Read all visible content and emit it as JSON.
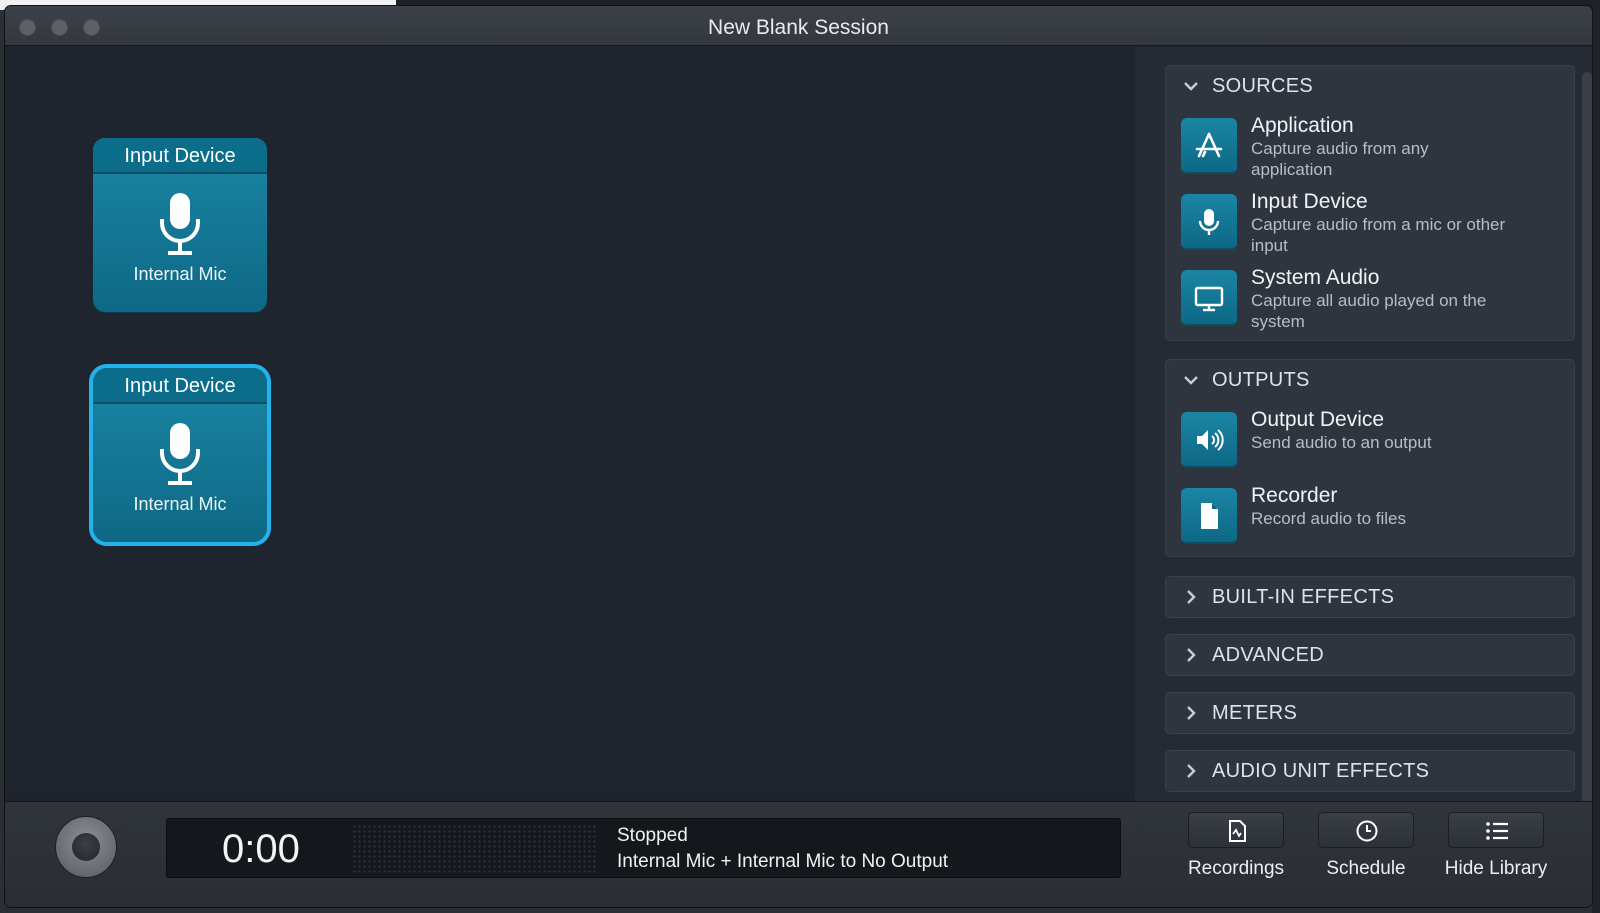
{
  "window": {
    "title": "New Blank Session"
  },
  "canvas": {
    "nodes": [
      {
        "header": "Input Device",
        "label": "Internal Mic",
        "selected": false
      },
      {
        "header": "Input Device",
        "label": "Internal Mic",
        "selected": true
      }
    ]
  },
  "library": {
    "sources": {
      "header": "SOURCES",
      "items": [
        {
          "title": "Application",
          "desc": "Capture audio from any application",
          "icon": "app-store-icon"
        },
        {
          "title": "Input Device",
          "desc": "Capture audio from a mic or other input",
          "icon": "microphone-icon"
        },
        {
          "title": "System Audio",
          "desc": "Capture all audio played on the system",
          "icon": "monitor-icon"
        }
      ]
    },
    "outputs": {
      "header": "OUTPUTS",
      "items": [
        {
          "title": "Output Device",
          "desc": "Send audio to an output",
          "icon": "speaker-icon"
        },
        {
          "title": "Recorder",
          "desc": "Record audio to files",
          "icon": "document-icon"
        }
      ]
    },
    "collapsed": [
      "BUILT-IN EFFECTS",
      "ADVANCED",
      "METERS",
      "AUDIO UNIT EFFECTS"
    ]
  },
  "transport": {
    "time": "0:00",
    "status": "Stopped",
    "route": "Internal Mic + Internal Mic to No Output"
  },
  "toolbar": {
    "recordings": "Recordings",
    "schedule": "Schedule",
    "hide_library": "Hide Library"
  },
  "colors": {
    "accent": "#23b3ec",
    "tile": "#0e6885"
  }
}
